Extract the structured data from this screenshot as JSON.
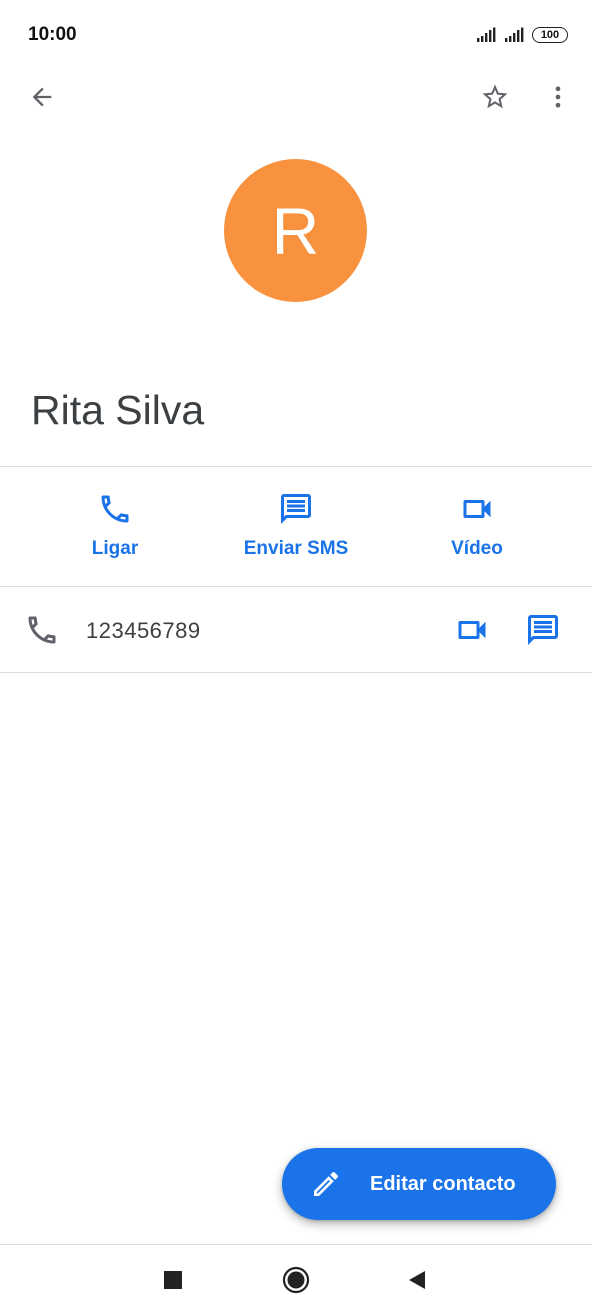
{
  "status_bar": {
    "time": "10:00",
    "battery": "100"
  },
  "top_bar": {
    "back_icon": "arrow-back-icon",
    "favorite_icon": "star-outline-icon",
    "more_icon": "more-vert-icon"
  },
  "contact": {
    "initial": "R",
    "name": "Rita Silva",
    "avatar_color": "#f8923f"
  },
  "actions": [
    {
      "label": "Ligar",
      "icon": "phone-icon"
    },
    {
      "label": "Enviar SMS",
      "icon": "message-icon"
    },
    {
      "label": "Vídeo",
      "icon": "videocam-icon"
    }
  ],
  "phone": {
    "number": "123456789"
  },
  "fab": {
    "label": "Editar contacto",
    "icon": "edit-pencil-icon"
  },
  "colors": {
    "accent": "#1a73e8",
    "avatar": "#f8923f",
    "divider": "#dadce0"
  },
  "nav_bar": {
    "recents_icon": "square-icon",
    "home_icon": "circle-icon",
    "back_icon": "triangle-back-icon"
  }
}
